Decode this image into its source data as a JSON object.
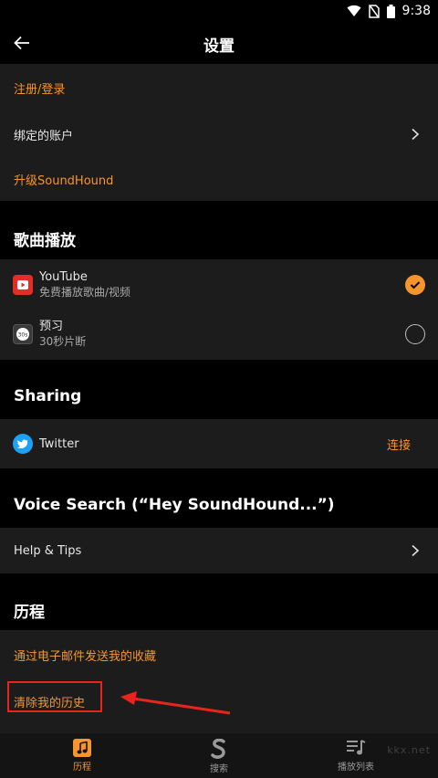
{
  "status_bar": {
    "time": "9:38"
  },
  "app_bar": {
    "title": "设置"
  },
  "account": {
    "register_login": "注册/登录",
    "bound_accounts": "绑定的账户",
    "upgrade": "升级SoundHound"
  },
  "song_playback": {
    "header": "歌曲播放",
    "youtube": {
      "title": "YouTube",
      "subtitle": "免费播放歌曲/视频",
      "selected": true
    },
    "preview": {
      "title": "预习",
      "subtitle": "30秒片断",
      "selected": false,
      "icon_text": "30s"
    }
  },
  "sharing": {
    "header": "Sharing",
    "twitter": {
      "label": "Twitter",
      "action": "连接"
    }
  },
  "voice_search": {
    "header": "Voice Search (“Hey SoundHound...”)",
    "help_tips": "Help & Tips"
  },
  "history": {
    "header": "历程",
    "email_favorites": "通过电子邮件发送我的收藏",
    "clear_history": "清除我的历史"
  },
  "tab_bar": {
    "tabs": [
      {
        "label": "历程",
        "icon": "music-note-icon",
        "active": true
      },
      {
        "label": "搜索",
        "icon": "soundhound-logo-icon",
        "active": false
      },
      {
        "label": "播放列表",
        "icon": "playlist-icon",
        "active": false
      }
    ]
  },
  "colors": {
    "accent": "#f5952c",
    "card": "#1c1c1c",
    "background": "#000000",
    "annotation": "#e8241c"
  },
  "watermark": "kkx.net"
}
